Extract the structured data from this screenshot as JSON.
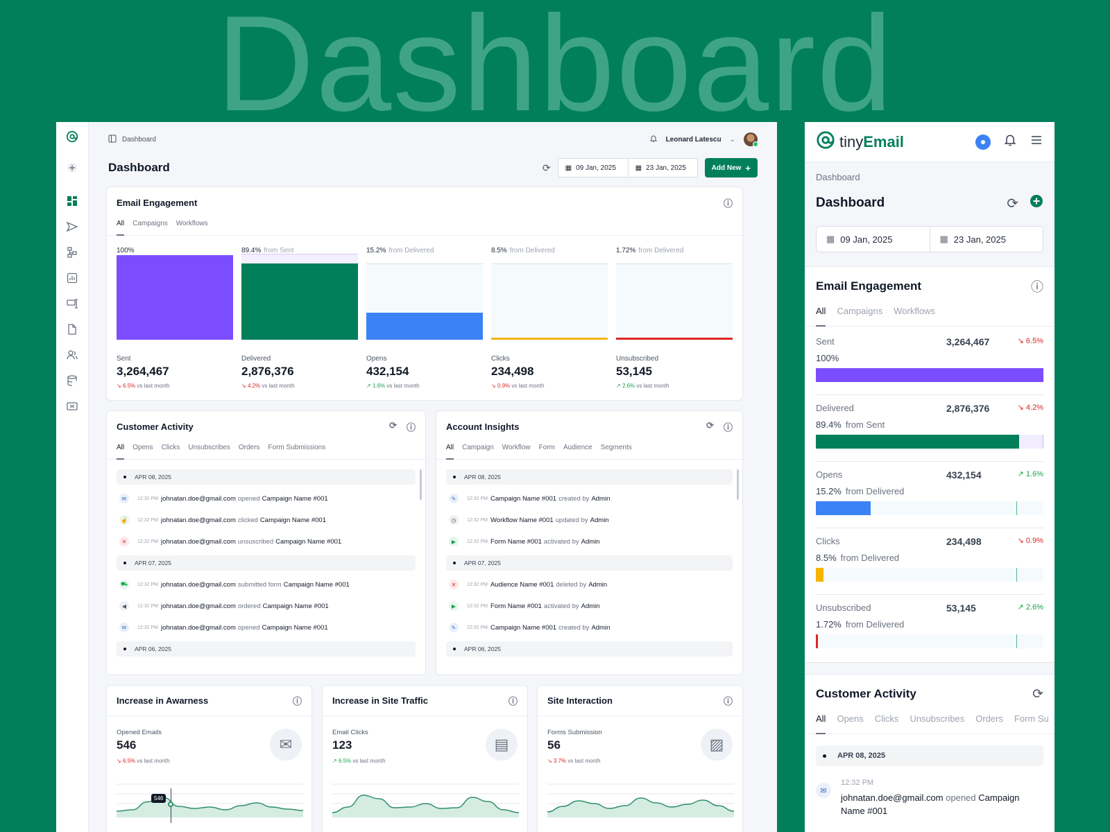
{
  "hero_title": "Dashboard",
  "colors": {
    "brand": "#017f5b",
    "sent": "#7c4dff",
    "delivered": "#017f5b",
    "opens": "#3b82f6",
    "clicks": "#f5b400",
    "unsubscribed": "#dc2626",
    "up": "#16a34a",
    "down": "#dc2626"
  },
  "desktop": {
    "breadcrumb": "Dashboard",
    "user_name": "Leonard Latescu",
    "page_title": "Dashboard",
    "date_from": "09 Jan, 2025",
    "date_to": "23 Jan, 2025",
    "add_new_label": "Add New",
    "engagement": {
      "title": "Email Engagement",
      "tabs": [
        "All",
        "Campaigns",
        "Workflows"
      ],
      "metrics": [
        {
          "pct": "100%",
          "from": "",
          "label": "Sent",
          "value": "3,264,467",
          "change": "6.5%",
          "dir": "down",
          "fill": 1.0,
          "color": "#7c4dff"
        },
        {
          "pct": "89.4%",
          "from": "from Sent",
          "label": "Delivered",
          "value": "2,876,376",
          "change": "4.2%",
          "dir": "down",
          "fill": 0.894,
          "color": "#017f5b"
        },
        {
          "pct": "15.2%",
          "from": "from Delivered",
          "label": "Opens",
          "value": "432,154",
          "change": "1.6%",
          "dir": "up",
          "fill": 0.35,
          "color": "#3b82f6"
        },
        {
          "pct": "8.5%",
          "from": "from Delivered",
          "label": "Clicks",
          "value": "234,498",
          "change": "0.9%",
          "dir": "down",
          "fill": 0.03,
          "color": "#f5b400"
        },
        {
          "pct": "1.72%",
          "from": "from Delivered",
          "label": "Unsubscribed",
          "value": "53,145",
          "change": "2.6%",
          "dir": "up",
          "fill": 0.012,
          "color": "#dc2626"
        }
      ],
      "vs_label": "vs last month"
    },
    "customer_activity": {
      "title": "Customer Activity",
      "tabs": [
        "All",
        "Opens",
        "Clicks",
        "Unsubscribes",
        "Orders",
        "Form Submissions"
      ],
      "items": [
        {
          "type": "day",
          "text": "APR 08, 2025"
        },
        {
          "type": "row",
          "icon": "envelope-icon",
          "time": "12:32 PM",
          "a": "johnatan.doe@gmail.com",
          "verb": "opened",
          "b": "Campaign Name #001"
        },
        {
          "type": "row",
          "icon": "click-icon",
          "time": "12:32 PM",
          "a": "johnatan.doe@gmail.com",
          "verb": "clicked",
          "b": "Campaign Name #001"
        },
        {
          "type": "row",
          "icon": "unsubscribe-icon",
          "time": "12:32 PM",
          "a": "johnatan.doe@gmail.com",
          "verb": "unsuscribed",
          "b": "Campaign Name #001"
        },
        {
          "type": "day",
          "text": "APR 07, 2025"
        },
        {
          "type": "row",
          "icon": "cart-icon",
          "time": "12:32 PM",
          "a": "johnatan.doe@gmail.com",
          "verb": "submitted form",
          "b": "Campaign Name #001"
        },
        {
          "type": "row",
          "icon": "megaphone-icon",
          "time": "12:32 PM",
          "a": "johnatan.doe@gmail.com",
          "verb": "ordered",
          "b": "Campaign Name #001"
        },
        {
          "type": "row",
          "icon": "envelope-icon",
          "time": "12:32 PM",
          "a": "johnatan.doe@gmail.com",
          "verb": "opened",
          "b": "Campaign Name #001"
        },
        {
          "type": "day",
          "text": "APR 06, 2025"
        }
      ]
    },
    "account_insights": {
      "title": "Account Insights",
      "tabs": [
        "All",
        "Campaign",
        "Workflow",
        "Form",
        "Audience",
        "Segments"
      ],
      "items": [
        {
          "type": "day",
          "text": "APR 08, 2025"
        },
        {
          "type": "row",
          "icon": "pencil-icon",
          "time": "12:32 PM",
          "a": "Campaign Name #001",
          "verb": "created by",
          "b": "Admin"
        },
        {
          "type": "row",
          "icon": "clock-icon",
          "time": "12:32 PM",
          "a": "Workflow Name #001",
          "verb": "updated by",
          "b": "Admin"
        },
        {
          "type": "row",
          "icon": "play-icon",
          "time": "12:32 PM",
          "a": "Form Name #001",
          "verb": "activated by",
          "b": "Admin"
        },
        {
          "type": "day",
          "text": "APR 07, 2025"
        },
        {
          "type": "row",
          "icon": "close-icon",
          "time": "12:32 PM",
          "a": "Audience Name #001",
          "verb": "deleted by",
          "b": "Admin"
        },
        {
          "type": "row",
          "icon": "play-icon",
          "time": "12:32 PM",
          "a": "Form Name #001",
          "verb": "activated by",
          "b": "Admin"
        },
        {
          "type": "row",
          "icon": "pencil-icon",
          "time": "12:32 PM",
          "a": "Campaign Name #001",
          "verb": "created by",
          "b": "Admin"
        },
        {
          "type": "day",
          "text": "APR 06, 2025"
        }
      ]
    },
    "kpis": [
      {
        "title": "Increase in Awarness",
        "label": "Opened Emails",
        "value": "546",
        "change": "6.5%",
        "dir": "down",
        "illus": "envelope-illustration-icon",
        "tooltip": "546"
      },
      {
        "title": "Increase in Site Traffic",
        "label": "Email Clicks",
        "value": "123",
        "change": "6.5%",
        "dir": "up",
        "illus": "browser-click-illustration-icon",
        "tooltip": ""
      },
      {
        "title": "Site Interaction",
        "label": "Forms Submission",
        "value": "56",
        "change": "3.7%",
        "dir": "down",
        "illus": "form-illustration-icon",
        "tooltip": ""
      }
    ]
  },
  "mobile": {
    "logo_text_a": "tiny",
    "logo_text_b": "Email",
    "breadcrumb": "Dashboard",
    "page_title": "Dashboard",
    "date_from": "09 Jan, 2025",
    "date_to": "23 Jan, 2025",
    "engagement_title": "Email Engagement",
    "engagement_tabs": [
      "All",
      "Campaigns",
      "Workflows"
    ],
    "metrics": [
      {
        "name": "Sent",
        "value": "3,264,467",
        "change": "6.5%",
        "dir": "down",
        "pct": "100%",
        "from": "",
        "fill": 1.0,
        "color": "#7c4dff",
        "tick": false
      },
      {
        "name": "Delivered",
        "value": "2,876,376",
        "change": "4.2%",
        "dir": "down",
        "pct": "89.4%",
        "from": "from Sent",
        "fill": 0.894,
        "color": "#017f5b",
        "tick": false
      },
      {
        "name": "Opens",
        "value": "432,154",
        "change": "1.6%",
        "dir": "up",
        "pct": "15.2%",
        "from": "from Delivered",
        "fill": 0.24,
        "color": "#3b82f6",
        "tick": true
      },
      {
        "name": "Clicks",
        "value": "234,498",
        "change": "0.9%",
        "dir": "down",
        "pct": "8.5%",
        "from": "from Delivered",
        "fill": 0.035,
        "color": "#f5b400",
        "tick": true
      },
      {
        "name": "Unsubscribed",
        "value": "53,145",
        "change": "2.6%",
        "dir": "up",
        "pct": "1.72%",
        "from": "from Delivered",
        "fill": 0.01,
        "color": "#dc2626",
        "tick": true
      }
    ],
    "activity_title": "Customer Activity",
    "activity_tabs": [
      "All",
      "Opens",
      "Clicks",
      "Unsubscribes",
      "Orders",
      "Form Su"
    ],
    "activity_day": "APR 08, 2025",
    "activity_time": "12:32 PM",
    "activity_email": "johnatan.doe@gmail.com",
    "activity_verb": "opened",
    "activity_target_a": "Campaign",
    "activity_target_b": "Name #001"
  }
}
